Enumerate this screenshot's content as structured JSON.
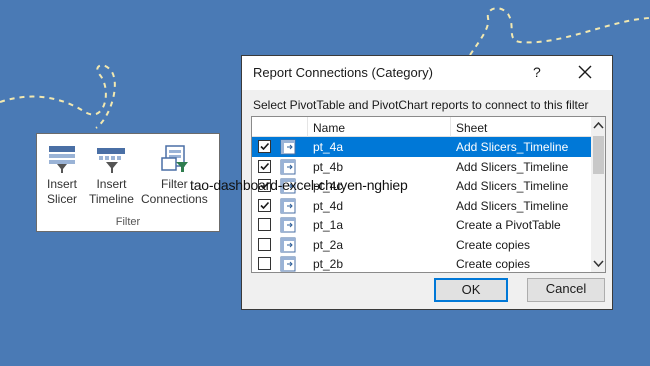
{
  "ribbon": {
    "buttons": [
      {
        "line1": "Insert",
        "line2": "Slicer",
        "icon": "slicer-icon"
      },
      {
        "line1": "Insert",
        "line2": "Timeline",
        "icon": "timeline-icon"
      },
      {
        "line1": "Filter",
        "line2": "Connections",
        "icon": "filter-connections-icon"
      }
    ],
    "group_label": "Filter"
  },
  "caption": "tao-dashboard-excel-chuyen-nghiep",
  "dialog": {
    "title": "Report Connections (Category)",
    "help": "?",
    "instruction": "Select PivotTable and PivotChart reports to connect to this filter",
    "columns": {
      "name": "Name",
      "sheet": "Sheet"
    },
    "rows": [
      {
        "name": "pt_4a",
        "sheet": "Add Slicers_Timeline",
        "checked": true,
        "selected": true
      },
      {
        "name": "pt_4b",
        "sheet": "Add Slicers_Timeline",
        "checked": true,
        "selected": false
      },
      {
        "name": "pt_4c",
        "sheet": "Add Slicers_Timeline",
        "checked": true,
        "selected": false
      },
      {
        "name": "pt_4d",
        "sheet": "Add Slicers_Timeline",
        "checked": true,
        "selected": false
      },
      {
        "name": "pt_1a",
        "sheet": "Create a PivotTable",
        "checked": false,
        "selected": false
      },
      {
        "name": "pt_2a",
        "sheet": "Create copies",
        "checked": false,
        "selected": false
      },
      {
        "name": "pt_2b",
        "sheet": "Create copies",
        "checked": false,
        "selected": false
      }
    ],
    "ok_label": "OK",
    "cancel_label": "Cancel"
  },
  "colors": {
    "background": "#4a7ab5",
    "accent": "#0078d7"
  }
}
